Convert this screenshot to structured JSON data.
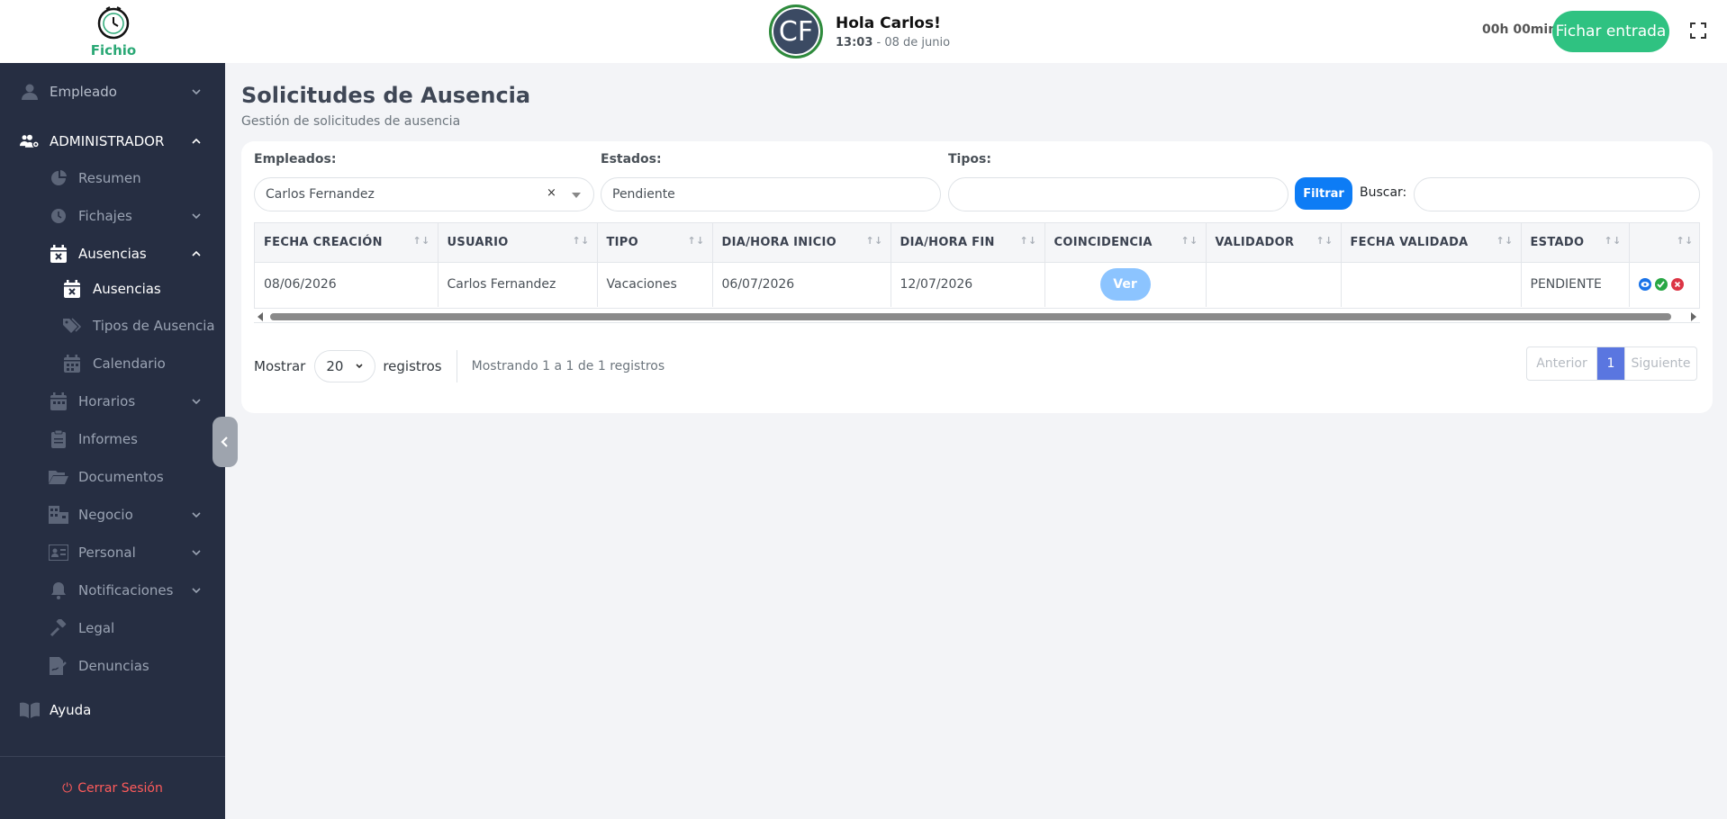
{
  "header": {
    "logo_text": "Fichio",
    "avatar_initials": "CF",
    "greeting": "Hola Carlos!",
    "time": "13:03",
    "date": " - 08 de junio",
    "timer": "00h 00min",
    "clock_in_label": "Fichar entrada"
  },
  "sidebar": {
    "employee": "Empleado",
    "admin": "ADMINISTRADOR",
    "resumen": "Resumen",
    "fichajes": "Fichajes",
    "ausencias": "Ausencias",
    "ausencias_sub": "Ausencias",
    "tipos_ausencia": "Tipos de Ausencia",
    "calendario": "Calendario",
    "horarios": "Horarios",
    "informes": "Informes",
    "documentos": "Documentos",
    "negocio": "Negocio",
    "personal": "Personal",
    "notificaciones": "Notificaciones",
    "legal": "Legal",
    "denuncias": "Denuncias",
    "ayuda": "Ayuda",
    "logout": "Cerrar Sesión"
  },
  "page": {
    "title": "Solicitudes de Ausencia",
    "subtitle": "Gestión de solicitudes de ausencia"
  },
  "filters": {
    "employees_label": "Empleados:",
    "employees_value": "Carlos Fernandez",
    "employees_clear": "×",
    "states_label": "Estados:",
    "states_value": "Pendiente",
    "types_label": "Tipos:",
    "types_value": "",
    "filter_button": "Filtrar",
    "search_label": "Buscar:",
    "search_value": ""
  },
  "table": {
    "columns": [
      "FECHA CREACIÓN",
      "USUARIO",
      "TIPO",
      "DIA/HORA INICIO",
      "DIA/HORA FIN",
      "COINCIDENCIA",
      "VALIDADOR",
      "FECHA VALIDADA",
      "ESTADO",
      ""
    ],
    "rows": [
      {
        "created": "08/06/2026",
        "user": "Carlos Fernandez",
        "type": "Vacaciones",
        "start": "06/07/2026",
        "end": "12/07/2026",
        "match_button": "Ver",
        "validator": "",
        "validated_date": "",
        "status": "PENDIENTE"
      }
    ]
  },
  "footer": {
    "show_label": "Mostrar",
    "page_length": "20",
    "records_label": "registros",
    "info": "Mostrando 1 a 1 de 1 registros",
    "prev": "Anterior",
    "current_page": "1",
    "next": "Siguiente"
  },
  "colors": {
    "sidebar_bg": "#262e42",
    "brand_green": "#2fc281",
    "primary_blue": "#0d7cf5",
    "pagination_active": "#5a76e0",
    "logout_red": "#ff5b5b"
  }
}
